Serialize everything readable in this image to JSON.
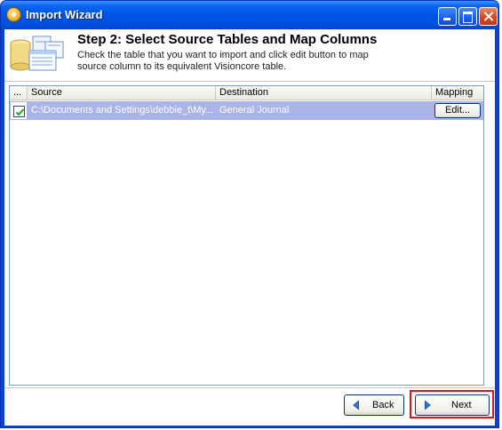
{
  "window": {
    "title": "Import Wizard"
  },
  "header": {
    "step_title": "Step 2: Select Source Tables and Map Columns",
    "description": "Check the table that you want to import and click edit button to map source column to its equivalent Visioncore table."
  },
  "grid": {
    "columns": [
      "...",
      "Source",
      "Destination",
      "Mapping"
    ],
    "rows": [
      {
        "checked": true,
        "source": "C:\\Documents and Settings\\debbie_t\\My...",
        "destination": "General Journal",
        "mapping_button": "Edit..."
      }
    ]
  },
  "footer": {
    "back_label": "Back",
    "next_label": "Next"
  },
  "colors": {
    "selected_row": "#aab4e6",
    "highlight_border": "#e0141e",
    "titlebar": "#0053e6"
  }
}
